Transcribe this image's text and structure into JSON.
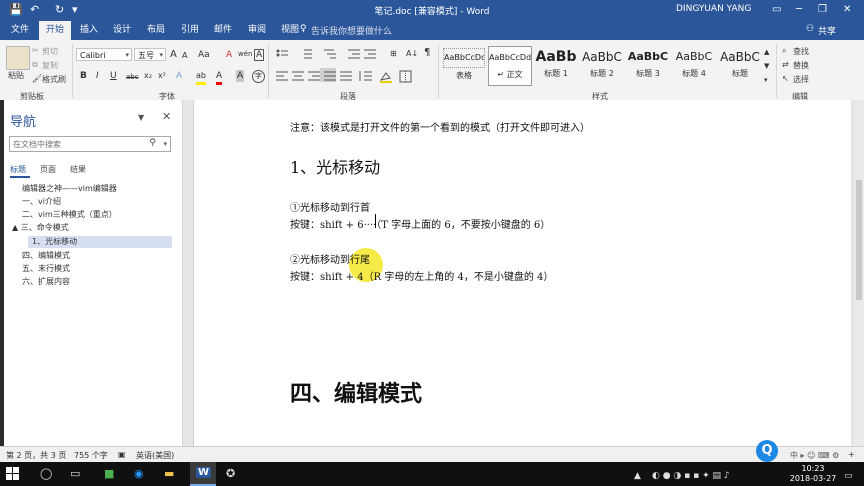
{
  "titlebar": {
    "title": "笔记.doc [兼容模式] - Word",
    "user": "DINGYUAN YANG",
    "save_icon": "💾",
    "undo_icon": "↶",
    "redo_icon": "↻",
    "qa_more": "▾",
    "ribbon_display": "▭",
    "minimize": "─",
    "restore": "❐",
    "close": "✕"
  },
  "tabs": [
    "文件",
    "开始",
    "插入",
    "设计",
    "布局",
    "引用",
    "邮件",
    "审阅",
    "视图"
  ],
  "tell_me": "告诉我你想要做什么",
  "tell_me_icon": "♀",
  "share": "共享",
  "share_icon": "⚇",
  "ribbon": {
    "clipboard": {
      "paste": "粘贴",
      "cut": "剪切",
      "copy": "复制",
      "format_painter": "格式刷",
      "label": "剪贴板"
    },
    "font": {
      "font_name": "Calibri",
      "font_size": "五号",
      "grow": "A",
      "shrink": "A",
      "case": "Aa",
      "clear": "A",
      "wen": "wén",
      "frame": "A",
      "bold": "B",
      "italic": "I",
      "underline": "U",
      "strike": "abc",
      "sub": "x₂",
      "sup": "x²",
      "effects": "A",
      "highlight": "ab",
      "color": "A",
      "char_shade": "A",
      "enclose": "字",
      "label": "字体"
    },
    "paragraph": {
      "label": "段落",
      "sort": "A↓",
      "show_marks": "¶"
    },
    "styles": {
      "label": "样式",
      "items": [
        {
          "preview": "AaBbCcDd",
          "name": "表格"
        },
        {
          "preview": "AaBbCcDd",
          "name": "↵ 正文"
        },
        {
          "preview": "AaBb",
          "name": "标题 1"
        },
        {
          "preview": "AaBbC",
          "name": "标题 2"
        },
        {
          "preview": "AaBbC",
          "name": "标题 3"
        },
        {
          "preview": "AaBbC",
          "name": "标题 4"
        },
        {
          "preview": "AaBbC",
          "name": "标题"
        }
      ]
    },
    "editing": {
      "find": "查找",
      "replace": "替换",
      "select": "选择",
      "label": "编辑"
    }
  },
  "nav": {
    "title": "导航",
    "search_placeholder": "在文档中搜索",
    "tabs": [
      "标题",
      "页面",
      "结果"
    ],
    "items": [
      "编辑器之神——vim编辑器",
      "一、vi介绍",
      "二、vim三种模式（重点）",
      "▲ 三、命令模式",
      "1、光标移动",
      "四、编辑模式",
      "五、末行模式",
      "六、扩展内容"
    ]
  },
  "document": {
    "note": "注意：该模式是打开文件的第一个看到的模式（打开文件即可进入）",
    "heading1": "1、光标移动",
    "sub1_title": "①光标移动到行首",
    "sub1_keys": "按键：shift + 6····（T 字母上面的 6，不要按小键盘的 6）",
    "sub2_title": "②光标移动到行尾",
    "sub2_keys": "按键：shift + 4（R 字母的左上角的 4，不是小键盘的 4）",
    "heading2": "四、编辑模式"
  },
  "status": {
    "page": "第 2 页，共 3 页",
    "words": "755 个字",
    "lang": "英语(美国)",
    "zoom": "+"
  },
  "taskbar": {
    "time": "10:23",
    "date": "2018-03-27",
    "ime": "中"
  }
}
